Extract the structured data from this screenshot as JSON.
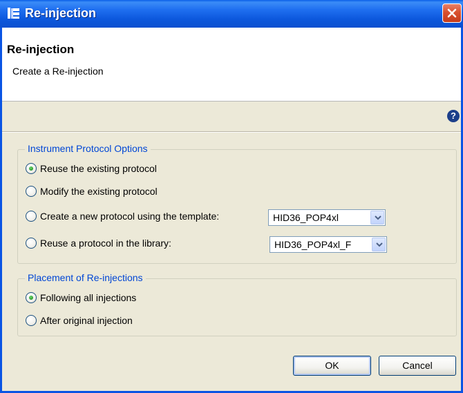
{
  "window": {
    "title": "Re-injection",
    "close_icon": "close-x-icon"
  },
  "header": {
    "title": "Re-injection",
    "description": "Create a Re-injection",
    "help_icon": "?"
  },
  "instrument_protocol": {
    "legend": "Instrument Protocol Options",
    "options": [
      {
        "label": "Reuse the existing protocol",
        "checked": true
      },
      {
        "label": "Modify the existing protocol",
        "checked": false
      },
      {
        "label": "Create a new protocol using the template:",
        "checked": false
      },
      {
        "label": "Reuse a protocol in the library:",
        "checked": false
      }
    ],
    "template_select": {
      "value": "HID36_POP4xl"
    },
    "library_select": {
      "value": "HID36_POP4xl_F"
    }
  },
  "placement": {
    "legend": "Placement of Re-injections",
    "options": [
      {
        "label": "Following all injections",
        "checked": true
      },
      {
        "label": "After original injection",
        "checked": false
      }
    ]
  },
  "buttons": {
    "ok_label": "OK",
    "cancel_label": "Cancel"
  },
  "colors": {
    "titlebar": "#0a55e0",
    "legend_text": "#0046d5",
    "dialog_bg": "#ece9d8"
  }
}
